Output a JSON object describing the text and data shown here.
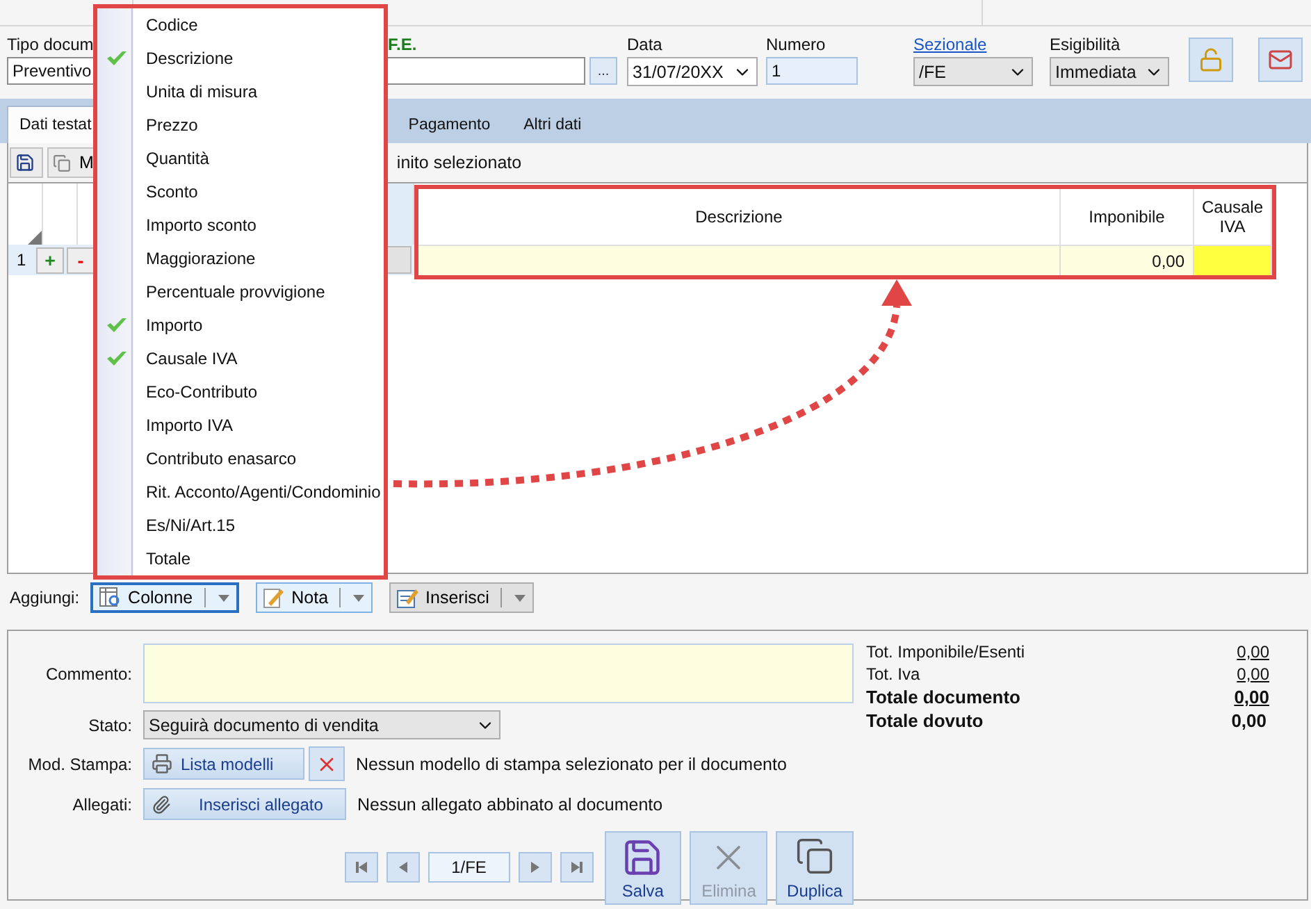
{
  "header": {
    "fields": [
      {
        "kind": "text",
        "label": "Tipo docum",
        "value": "Preventivo"
      },
      {
        "kind": "lookup",
        "label": "F.E.",
        "button": "..."
      },
      {
        "kind": "date",
        "label": "Data",
        "value": "31/07/20XX"
      },
      {
        "kind": "number",
        "label": "Numero",
        "value": "1"
      },
      {
        "kind": "select",
        "label": "Sezionale",
        "value": "/FE",
        "link": true
      },
      {
        "kind": "select",
        "label": "Esigibilità",
        "value": "Immediata",
        "link": false
      }
    ]
  },
  "tabs": [
    {
      "label": "Dati testat",
      "selected": true
    },
    {
      "label": "Pagamento",
      "selected": false
    },
    {
      "label": "Altri dati",
      "selected": false
    }
  ],
  "toolbar": {
    "button": "M",
    "note": "inito selezionato"
  },
  "grid": {
    "columns": [
      "Descrizione",
      "Imponibile",
      "Causale\nIVA"
    ],
    "rows": [
      {
        "number": "1",
        "add": "+",
        "remove": "-",
        "imponibile": "0,00"
      }
    ]
  },
  "column_menu": {
    "items": [
      {
        "label": "Codice",
        "checked": false
      },
      {
        "label": "Descrizione",
        "checked": true
      },
      {
        "label": "Unita di misura",
        "checked": false
      },
      {
        "label": "Prezzo",
        "checked": false
      },
      {
        "label": "Quantità",
        "checked": false
      },
      {
        "label": "Sconto",
        "checked": false
      },
      {
        "label": "Importo sconto",
        "checked": false
      },
      {
        "label": "Maggiorazione",
        "checked": false
      },
      {
        "label": "Percentuale provvigione",
        "checked": false
      },
      {
        "label": "Importo",
        "checked": true
      },
      {
        "label": "Causale IVA",
        "checked": true
      },
      {
        "label": "Eco-Contributo",
        "checked": false
      },
      {
        "label": "Importo IVA",
        "checked": false
      },
      {
        "label": "Contributo enasarco",
        "checked": false
      },
      {
        "label": "Rit. Acconto/Agenti/Condominio",
        "checked": false
      },
      {
        "label": "Es/Ni/Art.15",
        "checked": false
      },
      {
        "label": "Totale",
        "checked": false
      }
    ]
  },
  "add_bar": {
    "label": "Aggiungi:",
    "buttons": [
      {
        "label": "Colonne",
        "selected": true,
        "kind": "columns"
      },
      {
        "label": "Nota",
        "selected": false,
        "kind": "note"
      },
      {
        "label": "Inserisci",
        "selected": false,
        "kind": "insert"
      }
    ]
  },
  "footer": {
    "comment_label": "Commento:",
    "state_label": "Stato:",
    "state_value": "Seguirà documento di vendita",
    "print_label": "Mod. Stampa:",
    "print_button": "Lista modelli",
    "print_note": "Nessun modello di stampa selezionato per il documento",
    "attach_label": "Allegati:",
    "attach_button": "Inserisci allegato",
    "attach_note": "Nessun allegato abbinato al documento",
    "position": "1/FE",
    "actions": [
      {
        "label": "Salva",
        "kind": "save",
        "disabled": false
      },
      {
        "label": "Elimina",
        "kind": "delete",
        "disabled": true
      },
      {
        "label": "Duplica",
        "kind": "copy",
        "disabled": false
      }
    ],
    "totals": [
      {
        "kind": "minor",
        "label": "Tot. Imponibile/Esenti",
        "value": "0,00"
      },
      {
        "kind": "minor",
        "label": "Tot. Iva",
        "value": "0,00"
      },
      {
        "kind": "major",
        "label": "Totale documento",
        "value": "0,00"
      },
      {
        "kind": "due",
        "label": "Totale dovuto",
        "value": "0,00"
      }
    ]
  }
}
